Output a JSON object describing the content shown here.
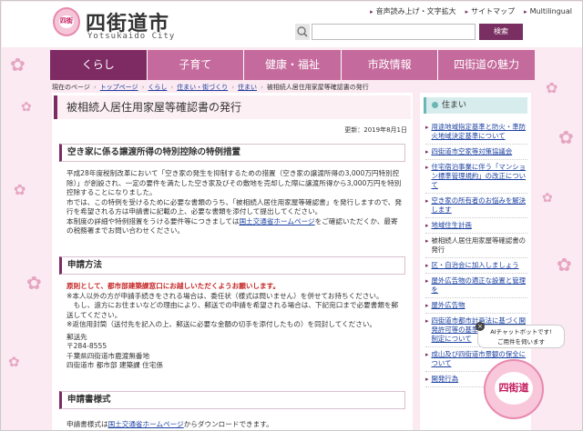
{
  "header": {
    "logo_title": "四街道市",
    "logo_sub": "Yotsukaido City",
    "logo_mark_text": "四街",
    "toplinks": [
      "音声読み上げ・文字拡大",
      "サイトマップ",
      "Multilingual"
    ],
    "search_button": "検索"
  },
  "nav": [
    "くらし",
    "子育て",
    "健康・福祉",
    "市政情報",
    "四街道の魅力"
  ],
  "breadcrumb": {
    "current_label": "現在のページ",
    "items": [
      "トップページ",
      "くらし",
      "住まい・街づくり",
      "住まい"
    ],
    "current": "被相続人居住用家屋等確認書の発行"
  },
  "main": {
    "title": "被相続人居住用家屋等確認書の発行",
    "updated": "更新：2019年8月1日",
    "sec1": "空き家に係る譲渡所得の特別控除の特例措置",
    "sec1_p1": "平成28年度税制改革において「空き家の発生を抑制するための措置（空き家の譲渡所得の3,000万円特別控除）」が創設され、一定の要件を満たした空き家及びその敷地を売却した際に譲渡所得から3,000万円を特別控除することになりました。",
    "sec1_p2": "市では、この特例を受けるために必要な書類のうち、「被相続人居住用家屋等確認書」を発行しますので、発行を希望される方は申請書に記載の上、必要な書類を添付して提出してください。",
    "sec1_p3a": "本制度の詳細や特例措置をうける要件等につきましては",
    "sec1_p3_link": "国土交通省ホームページ",
    "sec1_p3b": "をご確認いただくか、最寄の税務署までお問い合わせください。",
    "sec2": "申請方法",
    "sec2_red": "原則として、都市部建築課窓口にお越しいただくようお願いします。",
    "sec2_p1": "※本人以外の方が申請手続きをされる場合は、委任状（様式は問いません）を併せてお持ちください。",
    "sec2_p2": "　もし、遠方にお住まいなどの理由により、郵送での申請を希望される場合は、下記宛口まで必要書類を郵送してください。",
    "sec2_p3": "※返信用封筒（送付先を記入の上、郵送に必要な金額の切手を添付したもの）を同封してください。",
    "addr_label": "郵送先",
    "addr_zip": "〒284-8555",
    "addr_line1": "千葉県四街道市鹿渡無番地",
    "addr_line2": "四街道市 都市部 建築課 住宅係",
    "sec3": "申請書様式",
    "sec3_p_a": "申請書様式は",
    "sec3_p_link": "国土交通省ホームページ",
    "sec3_p_b": "からダウンロードできます。"
  },
  "side": {
    "title": "住まい",
    "items": [
      {
        "label": "用途地域指定基準と防火・準防火地域決定基準について",
        "current": false
      },
      {
        "label": "四街道市空家等対策協議会",
        "current": false
      },
      {
        "label": "住宅宿泊事業に伴う「マンション標準管理規約」の改正について",
        "current": false
      },
      {
        "label": "空き家の所有者のお悩みを解決します",
        "current": false
      },
      {
        "label": "地域住生計画",
        "current": false
      },
      {
        "label": "被相続人居住用家屋等確認書の発行",
        "current": true
      },
      {
        "label": "区・自治会に加入しましょう",
        "current": false
      },
      {
        "label": "屋外広告物の適正な設置と管理を",
        "current": false
      },
      {
        "label": "屋外広告物",
        "current": false
      },
      {
        "label": "四街道市都市計画法に基づく開発許可等の基準に関する条例の制定について",
        "current": false
      },
      {
        "label": "成山及び四街道市景観の保全について",
        "current": false
      },
      {
        "label": "開発行為",
        "current": false
      }
    ]
  },
  "chat": {
    "line1": "AIチャットボットです!",
    "line2": "ご用件を伺います",
    "mascot_text": "四街道"
  }
}
